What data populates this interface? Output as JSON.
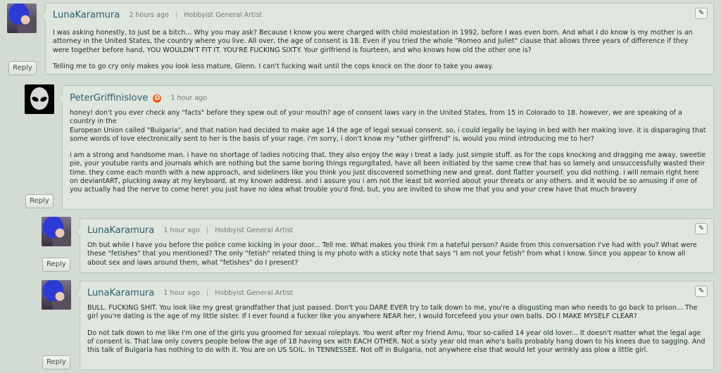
{
  "comments": [
    {
      "username": "LunaKaramura",
      "time": "2 hours ago",
      "separator": "|",
      "user_title": "Hobbyist General Artist",
      "paragraphs": [
        "I was asking honestly, to just be a bitch... Why you may ask? Because I know you were charged with child molestation in 1992, before I was even born. And what I do know is my mother is an attorney in the United States, the country where you live. All over, the age of consent is 18. Even if you tried the whole \"Romeo and Juliet\" clause that allows three years of difference if they were together before hand, YOU WOULDN'T FIT IT. YOU'RE FUCKING SIXTY. Your girlfriend is fourteen, and who knows how old the other one is?",
        "Telling me to go cry only makes you look less mature, Glenn. I can't fucking wait until the cops knock on the door to take you away."
      ],
      "reply_label": "Reply",
      "edit_icon": "pencil-icon"
    },
    {
      "username": "PeterGriffinislove",
      "time": "1 hour ago",
      "badge": "✪",
      "paragraphs": [
        "honey! don't you ever check any \"facts\" before they spew out of your mouth? age of consent laws vary in the United States, from 15 in Colorado to 18. however, we are speaking of a country in the\nEuropean Union called \"Bulgaria\", and that nation had decided to make age 14 the age of legal sexual consent. so, i could legally be laying in bed with her making love. it is disparaging that some words of love electronically sent to her is the basis of your rage. i'm sorry, i don't know my \"other girlfrend\" is, would you mind introducing me to her?",
        "i am a strong and handsome man. i have no shortage of ladies noticing that. they also enjoy the way i treat a lady. just simple stuff. as for the cops knocking and dragging me away, sweetie pie, your youtube rants and journals which are nothing but the same boring things  regurgitated, have all been initiated by the same crew that has so lamely and unsuccessfully wasted their time. they come each month with a new approach, and sideliners like you think you just discovered something new and great.  dont flatter yourself. you did nothing. i will remain right here on deviantART, plucking away at my keyboard, at my known address. and i assure you i am not the least bit worried about your threats or any others. and it would be so amusing if one of you actually had the nerve to come here! you just have no idea what trouble you'd find,  but, you are invited to show me that you and your crew have that much bravery"
      ],
      "reply_label": "Reply"
    },
    {
      "username": "LunaKaramura",
      "time": "1 hour ago",
      "separator": "|",
      "user_title": "Hobbyist General Artist",
      "paragraphs": [
        "Oh but while I have you before the police come kicking in your door... Tell me. What makes you think I'm a hateful person? Aside from this conversation I've had with you? What were these \"fetishes\" that you mentioned? The only \"fetish\" related thing is my photo with a sticky note that says \"I am not your fetish\" from what I know. Since you appear to know all about sex and laws around them, what \"fetishes\" do I present?"
      ],
      "reply_label": "Reply",
      "edit_icon": "pencil-icon"
    },
    {
      "username": "LunaKaramura",
      "time": "1 hour ago",
      "separator": "|",
      "user_title": "Hobbyist General Artist",
      "paragraphs": [
        "BULL. FUCKING SHIT. You look like my great grandfather that just passed. Don't you DARE EVER try to talk down to me, you're a disgusting man who needs to go back to prison... The girl you're dating is the age of my little sister. If I ever found a fucker like you anywhere NEAR her, I would forcefeed you your own balls. DO I MAKE MYSELF CLEAR?",
        "Do not talk down to me like I'm one of the girls you groomed for sexual roleplays. You went after my friend Amu, Your so-called 14 year old lover... It doesn't matter what the legal age of consent is. That law only covers people below the age of 18 having sex with EACH OTHER. Not a sixty year old man who's balls probably hang down to his knees due to sagging. And this talk of Bulgaria has nothing to do with it. You are on US SOIL. In TENNESSEE. Not off in Bulgaria, not anywhere else that would let your wrinkly ass plow a little girl."
      ],
      "reply_label": "Reply",
      "edit_icon": "pencil-icon"
    }
  ],
  "colors": {
    "background": "#d3dcd3",
    "card": "#dfe6de",
    "username": "#2b5c6f",
    "badge": "#e8621d"
  }
}
